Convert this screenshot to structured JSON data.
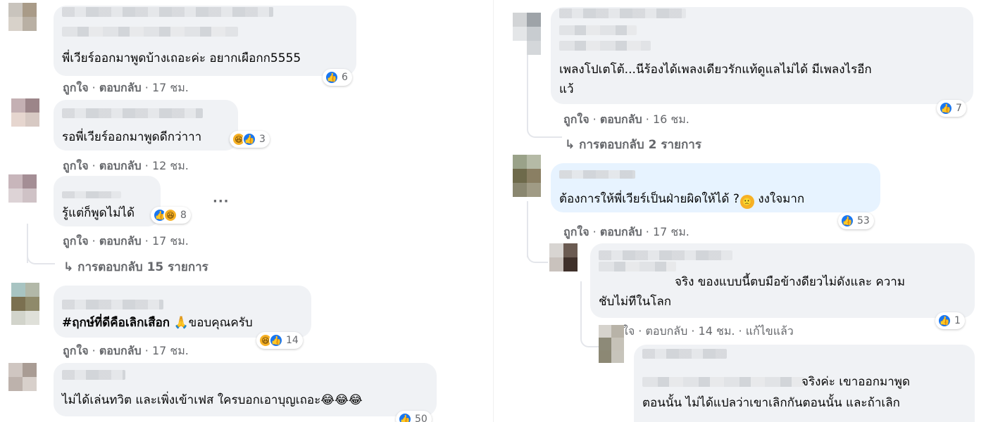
{
  "actions": {
    "like": "ถูกใจ",
    "reply": "ตอบกลับ",
    "separator": "·",
    "edited": "แก้ไขแล้ว"
  },
  "icons": {
    "like": "like-icon",
    "haha": "haha-icon",
    "sad": "sad-icon",
    "reply_arrow": "reply-arrow-icon",
    "more": "more-options-icon"
  },
  "colors": {
    "bubble": "#f0f2f5",
    "bubble_highlight": "#e7f3ff",
    "meta_text": "#65676b",
    "like_blue": "#1877f2",
    "haha_yellow": "#f7b125"
  },
  "left": {
    "comments": [
      {
        "text": "พี่เวียร์ออกมาพูดบ้างเถอะค่ะ อยากเผือกก5555",
        "reaction_count": "6",
        "time": "17 ชม."
      },
      {
        "text": "รอพี่เวียร์ออกมาพูดดีกว่าาา",
        "reaction_count": "3",
        "time": "12 ชม."
      },
      {
        "text": "รู้แต่ก็พูดไม่ได้",
        "reaction_count": "8",
        "time": "17 ชม.",
        "more": "···",
        "replies": "การตอบกลับ 15 รายการ"
      },
      {
        "hashtag": "#ฤกษ์ที่ดีคือเลิกเสือก",
        "text": "ขอบคุณครับ",
        "emoji": "🙏",
        "reaction_count": "14",
        "time": "17 ชม."
      },
      {
        "text": "ไม่ได้เล่นทวิต และเพิ่งเข้าเฟส ใครบอกเอาบุญเถอะ",
        "emojis": "😂😂😂",
        "reaction_count": "50"
      }
    ]
  },
  "right": {
    "comments": [
      {
        "line1": "เพลงโปเตโต้...นีร้องได้เพลงเดียวรักแท้ดูแลไม่ได้ มีเพลงไรอีก",
        "line2": "แว้",
        "reaction_count": "7",
        "time": "16 ชม.",
        "replies": "การตอบกลับ 2 รายการ"
      },
      {
        "text_before": "ต้องการให้พี่เวียร์เป็นฝ่ายผิดให้ได้ ?",
        "text_after": "งงใจมาก",
        "emoji": "🙁",
        "reaction_count": "53",
        "time": "17 ชม."
      },
      {
        "line1": "จริง ของแบบนี้ตบมือข้างดียวไม่ดังและ ความ",
        "line2": "ชับไม่ทีในโลก",
        "reaction_count": "1",
        "meta": "ใจ · ตอบกลับ · 14 ชม. · แก้ไขแล้ว"
      },
      {
        "line1": "จริงค่ะ เขาออกมาพูด",
        "line2": "ตอนนั้น ไม่ได้แปลว่าเขาเลิกกันตอนนั้น และถ้าเลิก"
      }
    ]
  }
}
